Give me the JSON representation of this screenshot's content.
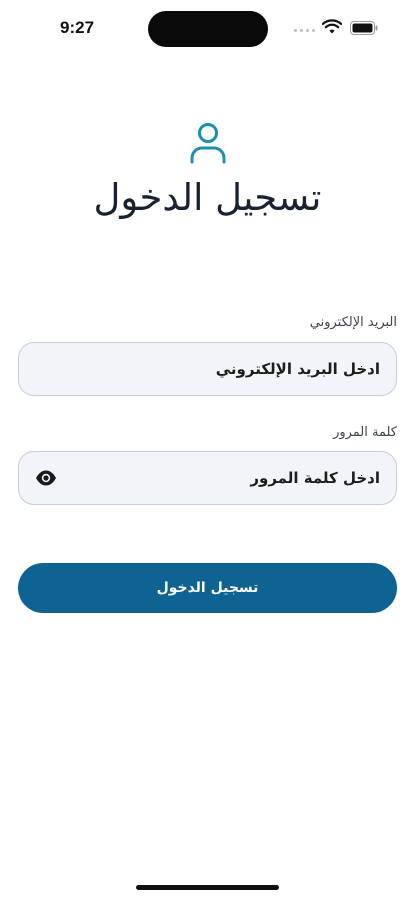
{
  "status_bar": {
    "time": "9:27",
    "icons": [
      "signal-dots",
      "wifi-icon",
      "battery-icon"
    ]
  },
  "header": {
    "icon": "user-icon",
    "title": "تسجيل الدخول"
  },
  "form": {
    "email": {
      "label": "البريد الإلكتروني",
      "placeholder": "ادخل البريد الإلكتروني",
      "value": ""
    },
    "password": {
      "label": "كلمة المرور",
      "placeholder": "ادخل كلمة المرور",
      "value": "",
      "toggle_icon": "eye-icon"
    },
    "submit_label": "تسجيل الدخول"
  },
  "colors": {
    "accent": "#0f6393",
    "icon_teal": "#1b8fb0",
    "field_bg": "#f1f4f9",
    "field_border": "#c8ced6",
    "title": "#1a2232"
  }
}
